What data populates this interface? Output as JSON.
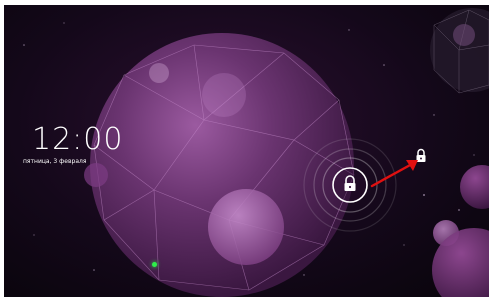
{
  "lockscreen": {
    "time": "12:00",
    "date": "пятница, 3 февраля"
  },
  "icons": {
    "unlock_handle": "lock-icon",
    "unlock_target": "lock-icon",
    "annotation": "red-arrow"
  },
  "colors": {
    "accent_arrow": "#e01010",
    "notification_led": "#2ef04a",
    "wallpaper_purple": "#6a3470"
  }
}
